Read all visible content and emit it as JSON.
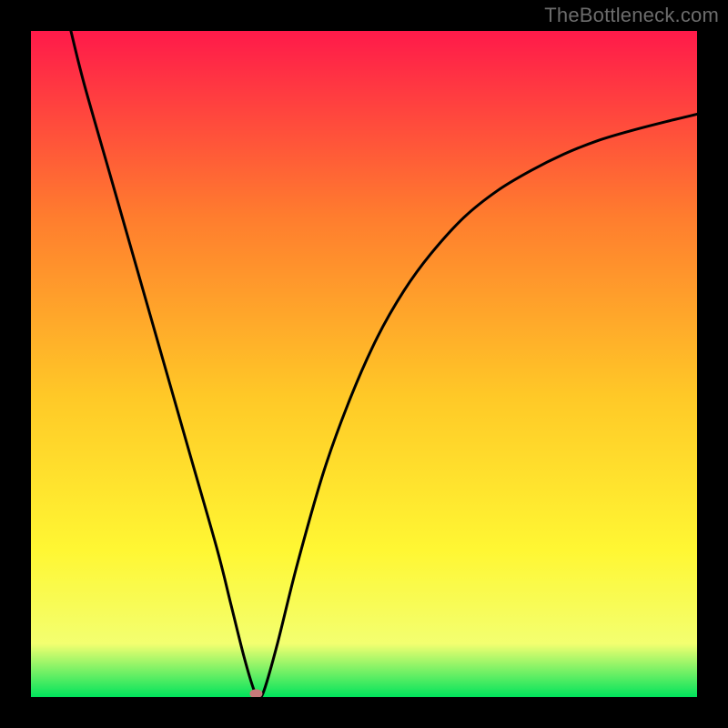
{
  "watermark": "TheBottleneck.com",
  "chart_data": {
    "type": "line",
    "title": "",
    "xlabel": "",
    "ylabel": "",
    "xlim": [
      0,
      100
    ],
    "ylim": [
      0,
      100
    ],
    "gradient_colors": {
      "top": "#ff1a4a",
      "upper_mid": "#ff7d2e",
      "mid": "#ffc927",
      "lower_mid": "#fff733",
      "low": "#f3ff70",
      "bottom": "#00e35c"
    },
    "curve": [
      {
        "x": 6.0,
        "y": 100.0
      },
      {
        "x": 8.0,
        "y": 92.0
      },
      {
        "x": 12.0,
        "y": 78.0
      },
      {
        "x": 16.0,
        "y": 64.0
      },
      {
        "x": 20.0,
        "y": 50.0
      },
      {
        "x": 24.0,
        "y": 36.0
      },
      {
        "x": 28.0,
        "y": 22.0
      },
      {
        "x": 30.0,
        "y": 14.0
      },
      {
        "x": 32.0,
        "y": 6.0
      },
      {
        "x": 33.5,
        "y": 1.0
      },
      {
        "x": 34.2,
        "y": 0.0
      },
      {
        "x": 35.0,
        "y": 1.0
      },
      {
        "x": 37.0,
        "y": 8.0
      },
      {
        "x": 40.0,
        "y": 20.0
      },
      {
        "x": 44.0,
        "y": 34.0
      },
      {
        "x": 48.0,
        "y": 45.0
      },
      {
        "x": 52.0,
        "y": 54.0
      },
      {
        "x": 56.0,
        "y": 61.0
      },
      {
        "x": 60.0,
        "y": 66.5
      },
      {
        "x": 65.0,
        "y": 72.0
      },
      {
        "x": 70.0,
        "y": 76.0
      },
      {
        "x": 75.0,
        "y": 79.0
      },
      {
        "x": 80.0,
        "y": 81.5
      },
      {
        "x": 85.0,
        "y": 83.5
      },
      {
        "x": 90.0,
        "y": 85.0
      },
      {
        "x": 95.0,
        "y": 86.3
      },
      {
        "x": 100.0,
        "y": 87.5
      }
    ],
    "marker": {
      "x": 33.8,
      "y": 0.5,
      "color": "#c77a7a",
      "rx": 7,
      "ry": 5
    }
  }
}
